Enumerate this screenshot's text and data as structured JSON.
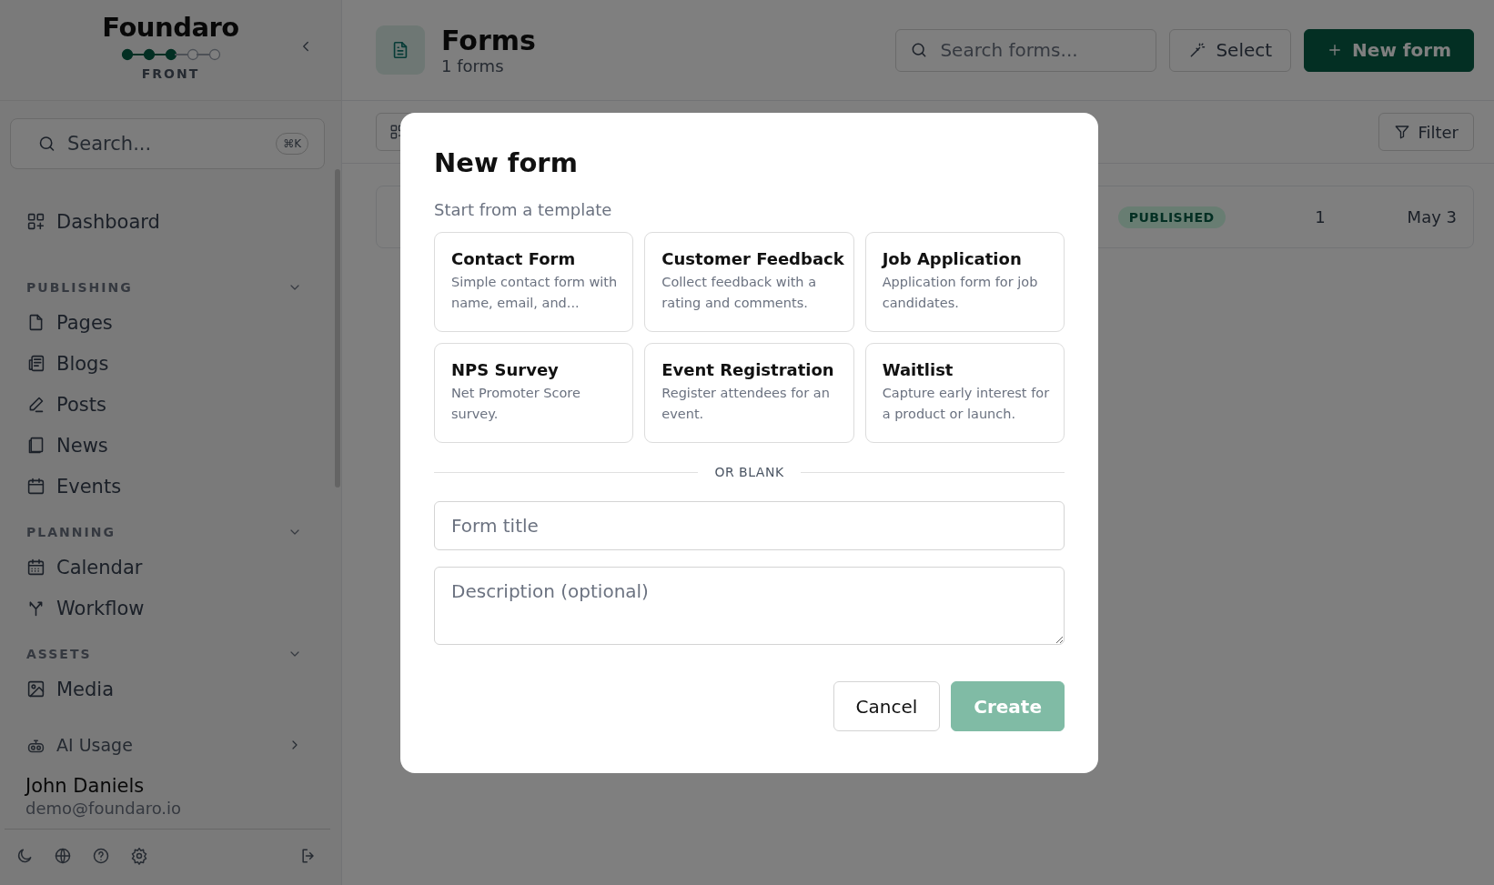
{
  "sidebar": {
    "logo": "Foundaro",
    "progress": [
      {
        "filled": true
      },
      {
        "filled": true
      },
      {
        "filled": true
      },
      {
        "filled": false
      },
      {
        "filled": false
      }
    ],
    "workspace": "FRONT",
    "search": {
      "placeholder": "Search...",
      "shortcut": "⌘K"
    },
    "top_items": [
      {
        "label": "Dashboard",
        "selected": false
      }
    ],
    "sections": [
      {
        "title": "PUBLISHING",
        "expanded": true,
        "items": [
          {
            "label": "Pages",
            "selected": false
          },
          {
            "label": "Blogs",
            "selected": false
          },
          {
            "label": "Posts",
            "selected": false
          },
          {
            "label": "News",
            "selected": false
          },
          {
            "label": "Events",
            "selected": false
          }
        ]
      },
      {
        "title": "PLANNING",
        "expanded": true,
        "items": [
          {
            "label": "Calendar",
            "selected": false
          },
          {
            "label": "Workflow",
            "selected": false
          }
        ]
      },
      {
        "title": "ASSETS",
        "expanded": true,
        "items": [
          {
            "label": "Media",
            "selected": false
          }
        ]
      }
    ],
    "ai_usage": {
      "label": "AI Usage"
    },
    "user": {
      "name": "John Daniels",
      "email": "demo@foundaro.io"
    }
  },
  "header": {
    "title": "Forms",
    "subtitle": "1 forms",
    "search": {
      "placeholder": "Search forms..."
    },
    "select_button": "Select",
    "new_button": "New form"
  },
  "toolbar": {
    "filter_button": "Filter"
  },
  "rows": [
    {
      "status": "PUBLISHED",
      "count": "1",
      "date": "May 3"
    }
  ],
  "modal": {
    "title": "New form",
    "subtitle": "Start from a template",
    "templates": [
      {
        "title": "Contact Form",
        "description": "Simple contact form with name, email, and..."
      },
      {
        "title": "Customer Feedback",
        "description": "Collect feedback with a rating and comments."
      },
      {
        "title": "Job Application",
        "description": "Application form for job candidates."
      },
      {
        "title": "NPS Survey",
        "description": "Net Promoter Score survey."
      },
      {
        "title": "Event Registration",
        "description": "Register attendees for an event."
      },
      {
        "title": "Waitlist",
        "description": "Capture early interest for a product or launch."
      }
    ],
    "divider": "OR BLANK",
    "title_field": {
      "placeholder": "Form title"
    },
    "description_field": {
      "placeholder": "Description (optional)"
    },
    "cancel": "Cancel",
    "create": {
      "label": "Create",
      "disabled": true
    }
  }
}
